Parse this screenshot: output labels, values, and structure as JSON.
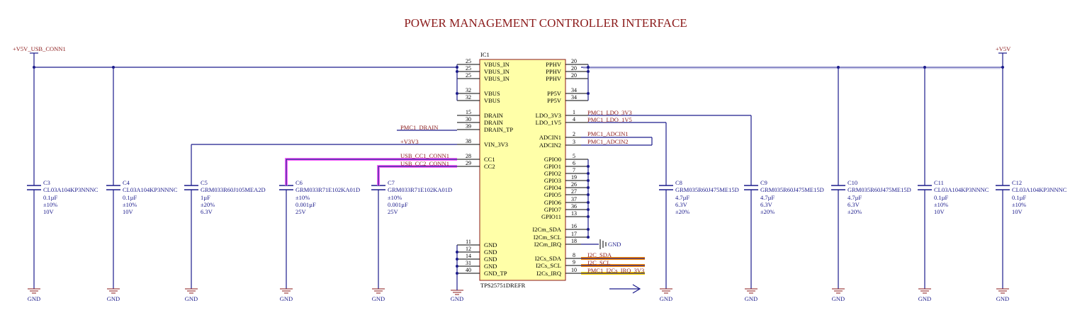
{
  "title": "POWER MANAGEMENT CONTROLLER INTERFACE",
  "power_left": "+V5V_USB_CONN1",
  "power_right": "+V5V",
  "ic": {
    "designator": "IC1",
    "part": "TPS25751DREFR",
    "left_pins": [
      {
        "num": "25",
        "name": "VBUS_IN"
      },
      {
        "num": "25",
        "name": "VBUS_IN"
      },
      {
        "num": "25",
        "name": "VBUS_IN"
      },
      {
        "num": "32",
        "name": "VBUS"
      },
      {
        "num": "32",
        "name": "VBUS"
      },
      {
        "num": "15",
        "name": "DRAIN"
      },
      {
        "num": "30",
        "name": "DRAIN"
      },
      {
        "num": "39",
        "name": "DRAIN_TP"
      },
      {
        "num": "38",
        "name": "VIN_3V3"
      },
      {
        "num": "28",
        "name": "CC1"
      },
      {
        "num": "29",
        "name": "CC2"
      },
      {
        "num": "11",
        "name": "GND"
      },
      {
        "num": "12",
        "name": "GND"
      },
      {
        "num": "14",
        "name": "GND"
      },
      {
        "num": "31",
        "name": "GND"
      },
      {
        "num": "40",
        "name": "GND_TP"
      }
    ],
    "right_pins": [
      {
        "num": "20",
        "name": "PPHV"
      },
      {
        "num": "20",
        "name": "PPHV"
      },
      {
        "num": "20",
        "name": "PPHV"
      },
      {
        "num": "34",
        "name": "PP5V"
      },
      {
        "num": "34",
        "name": "PP5V"
      },
      {
        "num": "1",
        "name": "LDO_3V3"
      },
      {
        "num": "4",
        "name": "LDO_1V5"
      },
      {
        "num": "2",
        "name": "ADCIN1"
      },
      {
        "num": "3",
        "name": "ADCIN2"
      },
      {
        "num": "5",
        "name": "GPIO0"
      },
      {
        "num": "6",
        "name": "GPIO1"
      },
      {
        "num": "7",
        "name": "GPIO2"
      },
      {
        "num": "19",
        "name": "GPIO3"
      },
      {
        "num": "26",
        "name": "GPIO4"
      },
      {
        "num": "27",
        "name": "GPIO5"
      },
      {
        "num": "37",
        "name": "GPIO6"
      },
      {
        "num": "36",
        "name": "GPIO7"
      },
      {
        "num": "13",
        "name": "GPIO11"
      },
      {
        "num": "16",
        "name": "I2Cm_SDA"
      },
      {
        "num": "17",
        "name": "I2Cm_SCL"
      },
      {
        "num": "18",
        "name": "I2Cm_IRQ"
      },
      {
        "num": "8",
        "name": "I2Cs_SDA"
      },
      {
        "num": "9",
        "name": "I2Cs_SCL"
      },
      {
        "num": "10",
        "name": "I2Cs_IRQ"
      }
    ]
  },
  "nets": {
    "pmc_drain": "PMC1_DRAIN",
    "v3v3": "+V3V3",
    "usb_cc1": "USB_CC1_CONN1",
    "usb_cc2": "USB_CC2_CONN1",
    "ldo_3v3": "PMC1_LDO_3V3",
    "ldo_1v5": "PMC1_LDO_1V5",
    "adcin1": "PMC1_ADCIN1",
    "adcin2": "PMC1_ADCIN2",
    "i2c_sda": "I2C_SDA",
    "i2c_scl": "I2C_SCL",
    "i2cs_irq": "PMC1_I2Cs_IRQ_3V3",
    "gnd": "GND"
  },
  "caps": [
    {
      "ref": "C3",
      "part": "CL03A104KP3NNNC",
      "value": "0.1µF",
      "tol": "±10%",
      "volt": "10V"
    },
    {
      "ref": "C4",
      "part": "CL03A104KP3NNNC",
      "value": "0.1µF",
      "tol": "±10%",
      "volt": "10V"
    },
    {
      "ref": "C5",
      "part": "GRM033R60J105MEA2D",
      "value": "1µF",
      "tol": "±20%",
      "volt": "6.3V"
    },
    {
      "ref": "C6",
      "part": "GRM033R71E102KA01D",
      "value": "±10%",
      "tol": "0.001µF",
      "volt": "25V"
    },
    {
      "ref": "C7",
      "part": "GRM033R71E102KA01D",
      "value": "±10%",
      "tol": "0.001µF",
      "volt": "25V"
    },
    {
      "ref": "C8",
      "part": "GRM035R60J475ME15D",
      "value": "4.7µF",
      "tol": "6.3V",
      "volt": "±20%"
    },
    {
      "ref": "C9",
      "part": "GRM035R60J475ME15D",
      "value": "4.7µF",
      "tol": "6.3V",
      "volt": "±20%"
    },
    {
      "ref": "C10",
      "part": "GRM035R60J475ME15D",
      "value": "4.7µF",
      "tol": "6.3V",
      "volt": "±20%"
    },
    {
      "ref": "C11",
      "part": "CL03A104KP3NNNC",
      "value": "0.1µF",
      "tol": "±10%",
      "volt": "10V"
    },
    {
      "ref": "C12",
      "part": "CL03A104KP3NNNC",
      "value": "0.1µF",
      "tol": "±10%",
      "volt": "10V"
    }
  ],
  "colors": {
    "wire": "#1c1c8c",
    "net_label": "#8b1a1a",
    "ic_fill": "#ffffa8",
    "cc_highlight": "#ff66ff",
    "i2c_highlight": "#ff8c00",
    "irq_highlight": "#ffd700"
  }
}
